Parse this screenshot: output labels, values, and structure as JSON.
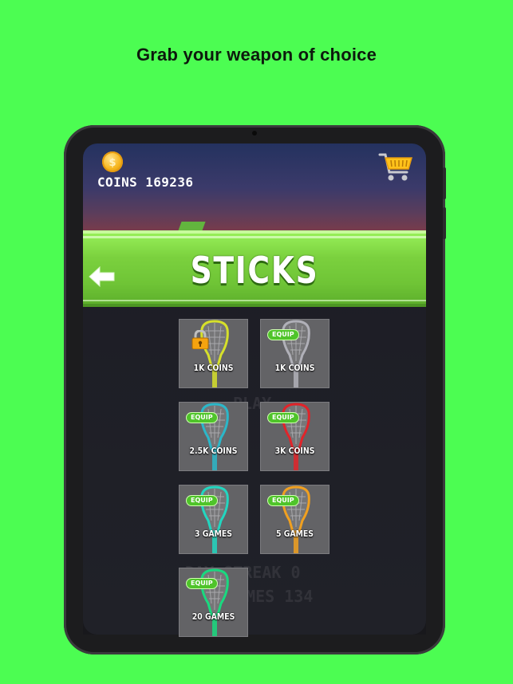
{
  "headline": "Grab your weapon of choice",
  "hud": {
    "coins_label": "COINS 169236",
    "coin_icon": "coin-icon",
    "cart_icon": "shopping-cart-icon"
  },
  "banner": {
    "title": "STICKS",
    "back_icon": "back-arrow-icon"
  },
  "background_text": {
    "play": "PLAY",
    "streak": "DAY STREAK   0",
    "games": "GAMES  134"
  },
  "sticks": [
    {
      "price": "1K COINS",
      "locked": true,
      "equip": "",
      "color": "#d6e02a"
    },
    {
      "price": "1K COINS",
      "locked": false,
      "equip": "EQUIP",
      "color": "#b0b0b8"
    },
    {
      "price": "2.5K COINS",
      "locked": false,
      "equip": "EQUIP",
      "color": "#2bb7c9"
    },
    {
      "price": "3K COINS",
      "locked": false,
      "equip": "EQUIP",
      "color": "#e0242a"
    },
    {
      "price": "3 GAMES",
      "locked": false,
      "equip": "EQUIP",
      "color": "#22d6c0"
    },
    {
      "price": "5 GAMES",
      "locked": false,
      "equip": "EQUIP",
      "color": "#f0a020"
    },
    {
      "price": "20 GAMES",
      "locked": false,
      "equip": "EQUIP",
      "color": "#19d97f"
    }
  ],
  "colors": {
    "page_bg": "#4cfd52",
    "banner_green": "#7bd13e",
    "tile_bg": "#636366",
    "equip_green": "#4fc42a"
  }
}
